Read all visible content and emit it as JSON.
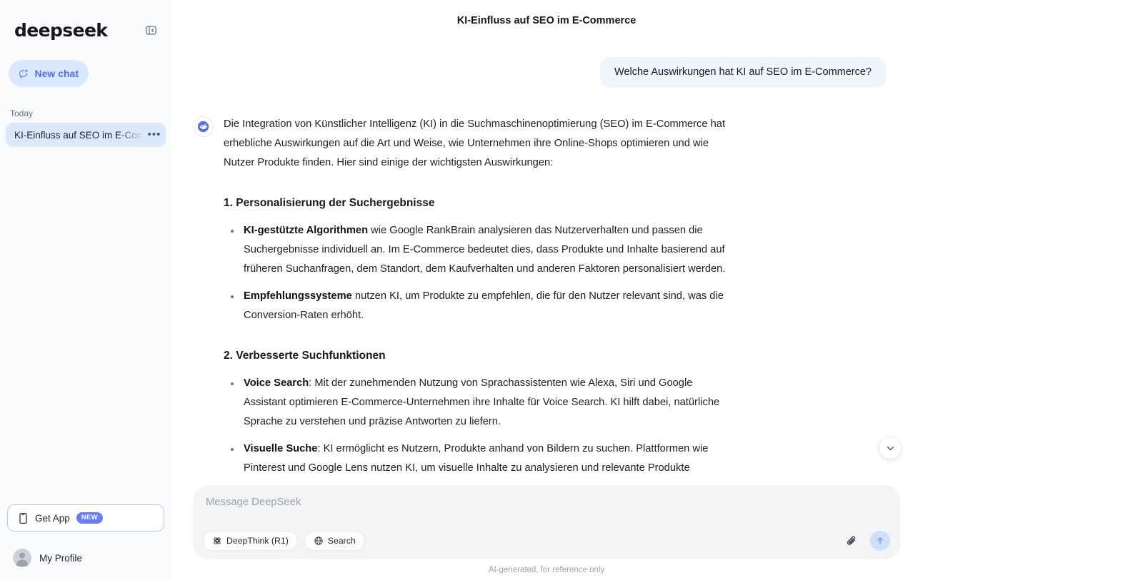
{
  "sidebar": {
    "brand": "deepseek",
    "collapse_icon": "sidebar-collapse-icon",
    "new_chat_label": "New chat",
    "new_chat_icon": "new-chat-bubble-plus-icon",
    "history_section_label": "Today",
    "history": [
      {
        "title": "KI-Einfluss auf SEO im E-Commerce",
        "active": true,
        "more_label": "•••"
      }
    ],
    "get_app": {
      "label": "Get App",
      "badge": "NEW",
      "icon": "mobile-phone-icon"
    },
    "profile": {
      "label": "My Profile",
      "icon": "user-avatar-icon"
    }
  },
  "header": {
    "title": "KI-Einfluss auf SEO im E-Commerce"
  },
  "conversation": {
    "user_message": "Welche Auswirkungen hat KI auf SEO im E-Commerce?",
    "assistant_avatar": "deepseek-whale-icon",
    "assistant_intro": "Die Integration von Künstlicher Intelligenz (KI) in die Suchmaschinenoptimierung (SEO) im E-Commerce hat erhebliche Auswirkungen auf die Art und Weise, wie Unternehmen ihre Online-Shops optimieren und wie Nutzer Produkte finden. Hier sind einige der wichtigsten Auswirkungen:",
    "sections": [
      {
        "heading": "1. Personalisierung der Suchergebnisse",
        "bullets": [
          {
            "lead": "KI-gestützte Algorithmen",
            "rest": " wie Google RankBrain analysieren das Nutzerverhalten und passen die Suchergebnisse individuell an. Im E-Commerce bedeutet dies, dass Produkte und Inhalte basierend auf früheren Suchanfragen, dem Standort, dem Kaufverhalten und anderen Faktoren personalisiert werden."
          },
          {
            "lead": "Empfehlungssysteme",
            "rest": " nutzen KI, um Produkte zu empfehlen, die für den Nutzer relevant sind, was die Conversion-Raten erhöht."
          }
        ]
      },
      {
        "heading": "2. Verbesserte Suchfunktionen",
        "bullets": [
          {
            "lead": "Voice Search",
            "rest": ": Mit der zunehmenden Nutzung von Sprachassistenten wie Alexa, Siri und Google Assistant optimieren E-Commerce-Unternehmen ihre Inhalte für Voice Search. KI hilft dabei, natürliche Sprache zu verstehen und präzise Antworten zu liefern."
          },
          {
            "lead": "Visuelle Suche",
            "rest": ": KI ermöglicht es Nutzern, Produkte anhand von Bildern zu suchen. Plattformen wie Pinterest und Google Lens nutzen KI, um visuelle Inhalte zu analysieren und relevante Produkte"
          }
        ]
      }
    ],
    "scroll_down_icon": "chevron-down-icon"
  },
  "composer": {
    "placeholder": "Message DeepSeek",
    "value": "",
    "deepthink_label": "DeepThink (R1)",
    "deepthink_icon": "atom-icon",
    "search_label": "Search",
    "search_icon": "globe-icon",
    "attach_icon": "paperclip-icon",
    "send_icon": "arrow-up-icon"
  },
  "disclaimer": "AI-generated, for reference only",
  "colors": {
    "accent_blue": "#4D6BFE",
    "user_bubble": "#EFF6FF",
    "sidebar_bg": "#F9FBFD",
    "active_chat_bg": "#DBE9FB",
    "badge_new": "#6C7BF5",
    "composer_bg": "#F3F4F6",
    "send_btn_bg": "#CFE0F8"
  }
}
